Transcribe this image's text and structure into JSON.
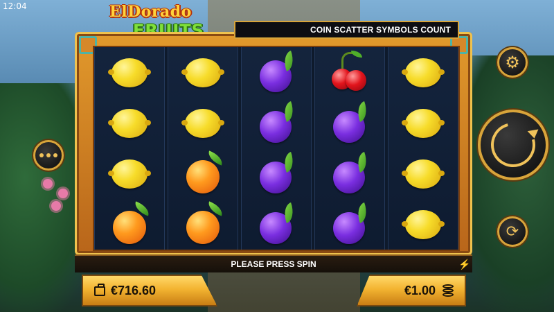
{
  "status_bar": {
    "time": "12:04"
  },
  "logo": {
    "line1": "ElDorado",
    "line2": "FRUITS"
  },
  "banner": {
    "text": "COIN SCATTER SYMBOLS COUNT"
  },
  "reels": [
    [
      "lemon",
      "lemon",
      "lemon",
      "orange"
    ],
    [
      "lemon",
      "lemon",
      "orange",
      "orange"
    ],
    [
      "plum",
      "plum",
      "plum",
      "plum"
    ],
    [
      "cherry",
      "plum",
      "plum",
      "plum"
    ],
    [
      "lemon",
      "lemon",
      "lemon",
      "lemon"
    ]
  ],
  "message": {
    "text": "PLEASE PRESS SPIN"
  },
  "balance": {
    "value": "€716.60",
    "icon": "wallet-icon"
  },
  "bet": {
    "value": "€1.00",
    "icon": "coins-icon"
  },
  "controls": {
    "settings_icon": "gear-icon",
    "spin_icon": "spin-icon",
    "autoplay_icon": "autoplay-icon",
    "menu_icon": "more-icon"
  },
  "colors": {
    "frame_gold": "#e29a2c",
    "reel_bg": "#0e1a2c",
    "panel_gold": "#f3b431",
    "accent_gold": "#f0c25a"
  }
}
